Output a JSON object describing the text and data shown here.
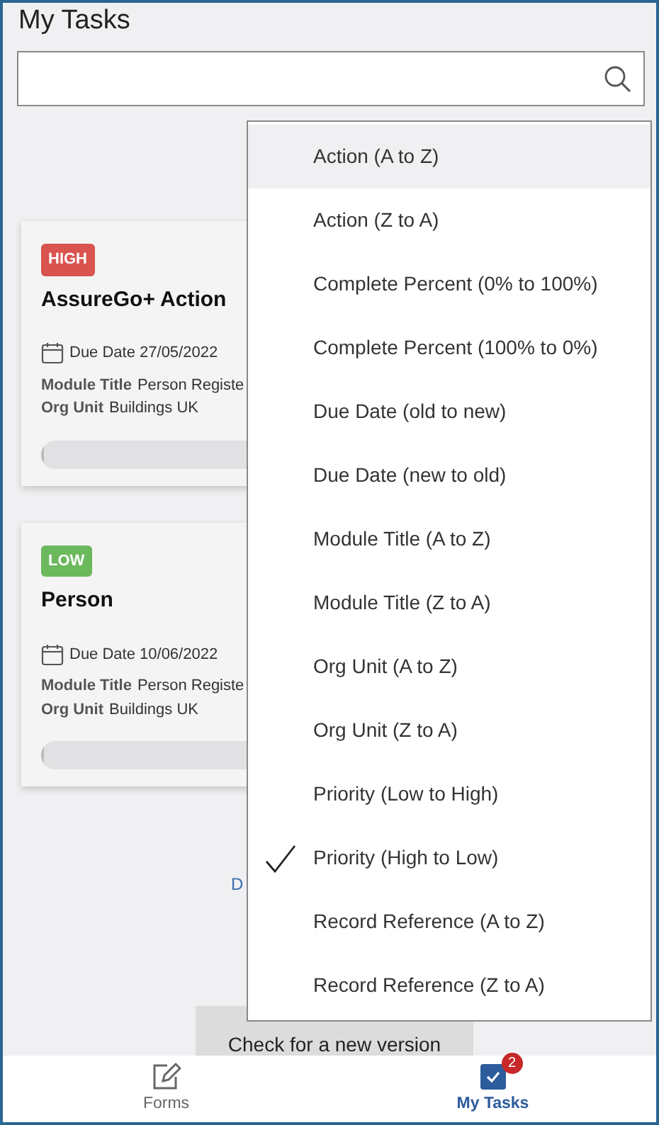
{
  "header": {
    "title": "My Tasks"
  },
  "tasks": [
    {
      "priority": "HIGH",
      "color": "#d9534f",
      "title": "AssureGo+ Action",
      "due_label": "Due Date",
      "due_date": "27/05/2022",
      "module_label": "Module Title",
      "module_value": "Person Registe",
      "org_label": "Org Unit",
      "org_value": "Buildings UK",
      "level": 0
    },
    {
      "priority": "LOW",
      "color": "#6cb85c",
      "title": "Person",
      "due_label": "Due Date",
      "due_date": "10/06/2022",
      "module_label": "Module Title",
      "module_value": "Person Registe",
      "org_label": "Org Unit",
      "org_value": "Buildings UK",
      "level": 0
    }
  ],
  "partial_link": "D",
  "version_button": "Check for a new version",
  "sort_menu": [
    {
      "label": "Action (A to Z)",
      "selected": false,
      "hovered": true
    },
    {
      "label": "Action (Z to A)",
      "selected": false,
      "hovered": false
    },
    {
      "label": "Complete Percent (0% to 100%)",
      "selected": false,
      "hovered": false
    },
    {
      "label": "Complete Percent (100% to 0%)",
      "selected": false,
      "hovered": false
    },
    {
      "label": "Due Date (old to new)",
      "selected": false,
      "hovered": false
    },
    {
      "label": "Due Date (new to old)",
      "selected": false,
      "hovered": false
    },
    {
      "label": "Module Title (A to Z)",
      "selected": false,
      "hovered": false
    },
    {
      "label": "Module Title (Z to A)",
      "selected": false,
      "hovered": false
    },
    {
      "label": "Org Unit (A to Z)",
      "selected": false,
      "hovered": false
    },
    {
      "label": "Org Unit (Z to A)",
      "selected": false,
      "hovered": false
    },
    {
      "label": "Priority (Low to High)",
      "selected": false,
      "hovered": false
    },
    {
      "label": "Priority (High to Low)",
      "selected": true,
      "hovered": false
    },
    {
      "label": "Record Reference (A to Z)",
      "selected": false,
      "hovered": false
    },
    {
      "label": "Record Reference (Z to A)",
      "selected": false,
      "hovered": false
    }
  ],
  "bottom_nav": [
    {
      "kind": "forms",
      "label": "Forms",
      "selected": false
    },
    {
      "kind": "tasks",
      "label": "My Tasks",
      "selected": true,
      "badge": "2"
    }
  ]
}
